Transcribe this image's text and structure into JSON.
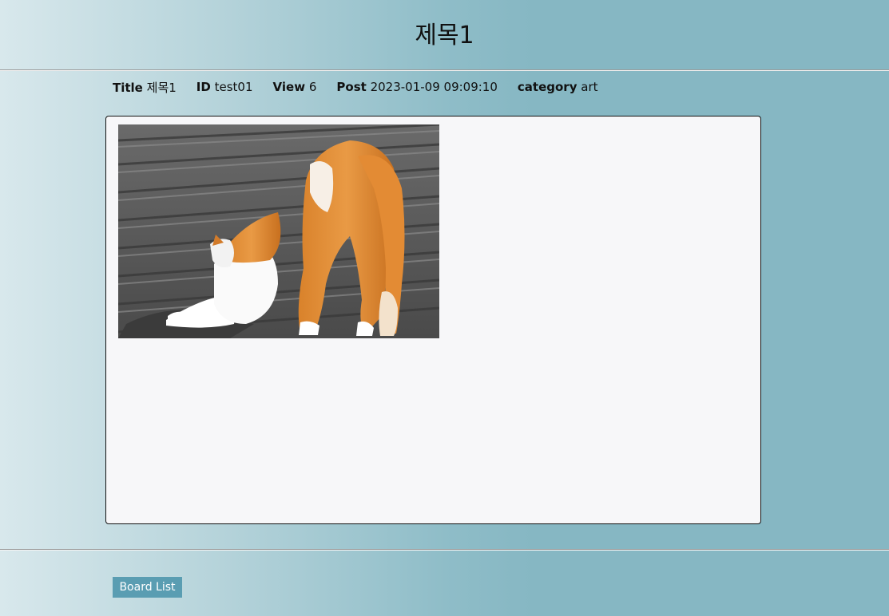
{
  "page": {
    "title": "제목1"
  },
  "meta": {
    "title_key": "Title",
    "title_value": "제목1",
    "id_key": "ID",
    "id_value": "test01",
    "view_key": "View",
    "view_value": "6",
    "post_key": "Post",
    "post_value": "2023-01-09 09:09:10",
    "category_key": "category",
    "category_value": "art"
  },
  "content": {
    "image_subject": "orange-and-white cat stretching on roof tiles"
  },
  "footer": {
    "board_list_label": "Board List"
  },
  "colors": {
    "button_bg": "#5a9db2",
    "content_bg": "#f7f7f9",
    "gradient_end": "#86b7c3"
  }
}
